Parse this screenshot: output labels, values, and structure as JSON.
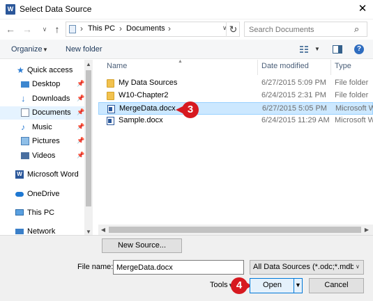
{
  "window": {
    "title": "Select Data Source",
    "title_icon": "W"
  },
  "nav": {
    "back": "←",
    "forward": "→",
    "recent": "∨",
    "up": "↑",
    "crumbs": [
      "This PC",
      "Documents"
    ],
    "refresh": "↻",
    "search_placeholder": "Search Documents"
  },
  "toolbar": {
    "organize": "Organize",
    "new_folder": "New folder",
    "help": "?"
  },
  "sidebar": {
    "items": [
      {
        "label": "Quick access",
        "icon": "star-icon"
      },
      {
        "label": "Desktop",
        "icon": "desktop-icon",
        "pinned": true
      },
      {
        "label": "Downloads",
        "icon": "download-icon",
        "pinned": true
      },
      {
        "label": "Documents",
        "icon": "documents-icon",
        "pinned": true,
        "selected": true
      },
      {
        "label": "Music",
        "icon": "music-icon",
        "pinned": true
      },
      {
        "label": "Pictures",
        "icon": "pictures-icon",
        "pinned": true
      },
      {
        "label": "Videos",
        "icon": "videos-icon",
        "pinned": true
      },
      {
        "label": "Microsoft Word",
        "icon": "word-icon"
      },
      {
        "label": "OneDrive",
        "icon": "cloud-icon"
      },
      {
        "label": "This PC",
        "icon": "computer-icon"
      },
      {
        "label": "Network",
        "icon": "network-icon"
      }
    ]
  },
  "filelist": {
    "columns": [
      "Name",
      "Date modified",
      "Type"
    ],
    "rows": [
      {
        "name": "My Data Sources",
        "date": "6/27/2015 5:09 PM",
        "type": "File folder",
        "icon": "folder-icon"
      },
      {
        "name": "W10-Chapter2",
        "date": "6/24/2015 2:31 PM",
        "type": "File folder",
        "icon": "folder-icon"
      },
      {
        "name": "MergeData.docx",
        "date": "6/27/2015 5:05 PM",
        "type": "Microsoft W",
        "icon": "word-doc-icon",
        "selected": true
      },
      {
        "name": "Sample.docx",
        "date": "6/24/2015 11:29 AM",
        "type": "Microsoft W",
        "icon": "word-doc-icon"
      }
    ]
  },
  "bottom": {
    "new_source": "New Source...",
    "file_name_label": "File name:",
    "file_name_value": "MergeData.docx",
    "filter": "All Data Sources (*.odc;*.mdb;*",
    "tools": "Tools",
    "open": "Open",
    "cancel": "Cancel"
  },
  "callouts": {
    "step_select": "3",
    "step_open": "4"
  },
  "colors": {
    "callout": "#d71920",
    "selection": "#cce8ff",
    "accent": "#0078d7"
  }
}
